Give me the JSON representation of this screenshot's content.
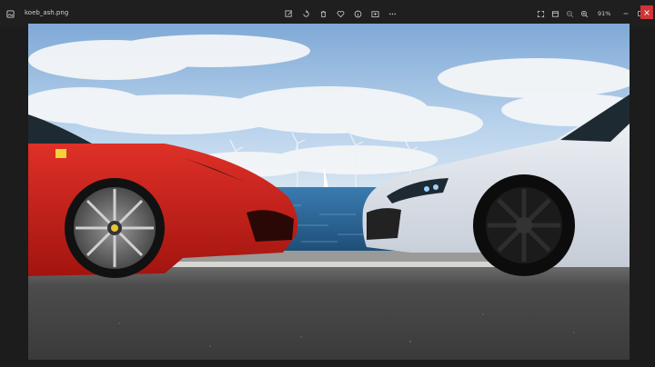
{
  "window": {
    "file_name": "koeb_ash.png",
    "zoom": "91%"
  },
  "toolbar": {
    "center_icons": [
      "edit-icon",
      "rotate-icon",
      "delete-icon",
      "heart-icon",
      "info-icon",
      "share-icon",
      "more-icon"
    ],
    "right_icons": [
      "fullscreen-icon",
      "slideshow-icon",
      "zoom-out-icon",
      "zoom-in-icon"
    ]
  },
  "colors": {
    "chrome_bg": "#1f1f1f",
    "close_red": "#d13438",
    "ferrari_red": "#d1211a",
    "audi_white": "#e7ecf2",
    "sky": "#9fc3e8",
    "sea": "#2f6a95",
    "road": "#4b4b4b"
  },
  "image": {
    "subject": "red Ferrari and white Audi facing each other by the sea"
  }
}
